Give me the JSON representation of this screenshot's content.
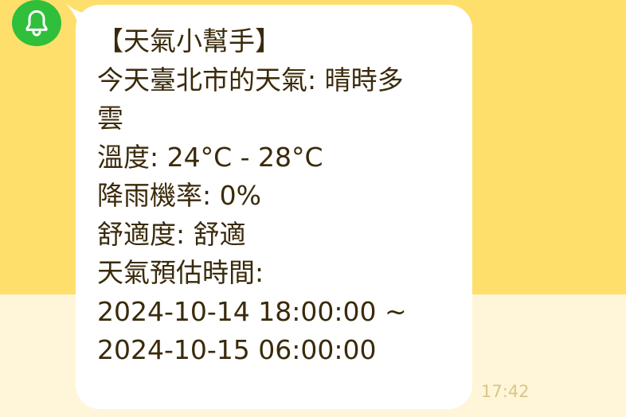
{
  "colors": {
    "background_top": "#ffdf6b",
    "background_bottom": "#fff6d9",
    "avatar": "#2fbf3a",
    "bubble": "#ffffff",
    "message_text": "#3a2a0a",
    "timestamp_text": "#d8c68a"
  },
  "sender": {
    "avatar_icon": "bell-icon"
  },
  "message": {
    "lines": [
      "【天氣小幫手】",
      "今天臺北市的天氣: 晴時多",
      "雲",
      "溫度: 24°C - 28°C",
      "降雨機率: 0%",
      "舒適度: 舒適",
      "天氣預估時間:",
      "2024-10-14 18:00:00 ~",
      "2024-10-15 06:00:00"
    ],
    "time": "17:42"
  }
}
